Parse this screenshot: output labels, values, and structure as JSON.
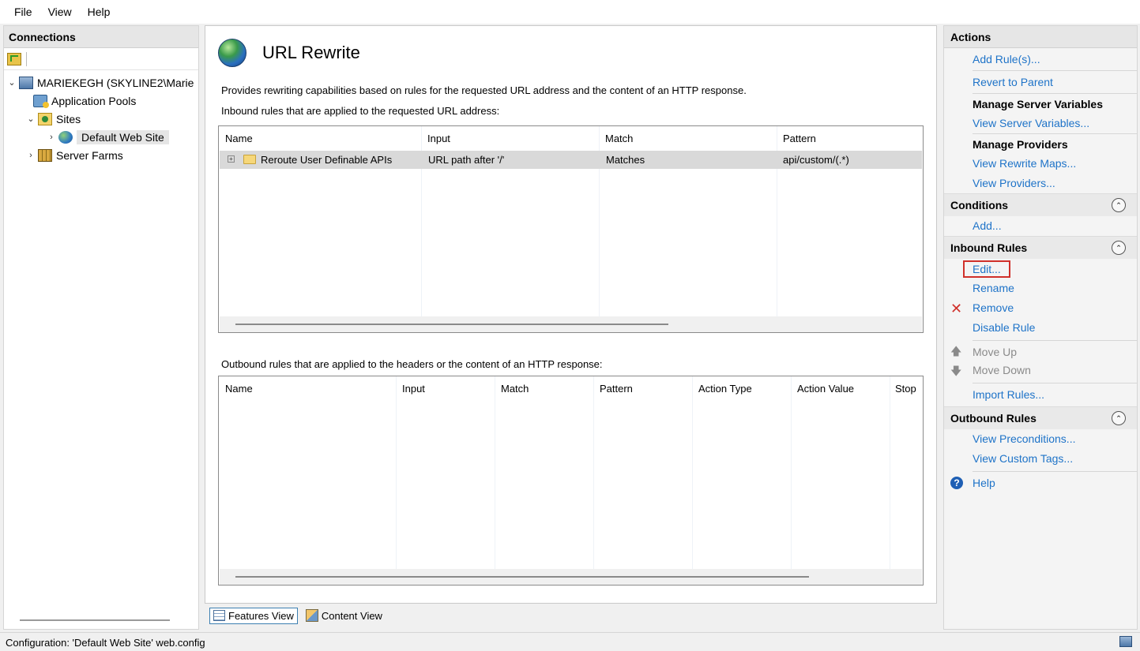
{
  "menubar": {
    "items": [
      "File",
      "View",
      "Help"
    ]
  },
  "connections": {
    "title": "Connections",
    "tree": {
      "server": "MARIEKEGH (SKYLINE2\\Marie",
      "app_pools": "Application Pools",
      "sites": "Sites",
      "default_site": "Default Web Site",
      "server_farms": "Server Farms"
    }
  },
  "main": {
    "title": "URL Rewrite",
    "description": "Provides rewriting capabilities based on rules for the requested URL address and the content of an HTTP response.",
    "inbound_caption": "Inbound rules that are applied to the requested URL address:",
    "inbound_columns": [
      "Name",
      "Input",
      "Match",
      "Pattern"
    ],
    "inbound_rows": [
      {
        "name": "Reroute User Definable APIs",
        "input": "URL path after '/'",
        "match": "Matches",
        "pattern": "api/custom/(.*)"
      }
    ],
    "outbound_caption": "Outbound rules that are applied to the headers or the content of an HTTP response:",
    "outbound_columns": [
      "Name",
      "Input",
      "Match",
      "Pattern",
      "Action Type",
      "Action Value",
      "Stop"
    ]
  },
  "viewbar": {
    "features_view": "Features View",
    "content_view": "Content View"
  },
  "actions": {
    "title": "Actions",
    "add_rules": "Add Rule(s)...",
    "revert": "Revert to Parent",
    "manage_server_vars": "Manage Server Variables",
    "view_server_vars": "View Server Variables...",
    "manage_providers": "Manage Providers",
    "view_rewrite_maps": "View Rewrite Maps...",
    "view_providers": "View Providers...",
    "conditions": "Conditions",
    "conditions_add": "Add...",
    "inbound_rules": "Inbound Rules",
    "edit": "Edit...",
    "rename": "Rename",
    "remove": "Remove",
    "disable_rule": "Disable Rule",
    "move_up": "Move Up",
    "move_down": "Move Down",
    "import_rules": "Import Rules...",
    "outbound_rules": "Outbound Rules",
    "view_preconditions": "View Preconditions...",
    "view_custom_tags": "View Custom Tags...",
    "help": "Help"
  },
  "statusbar": {
    "text": "Configuration: 'Default Web Site' web.config"
  }
}
